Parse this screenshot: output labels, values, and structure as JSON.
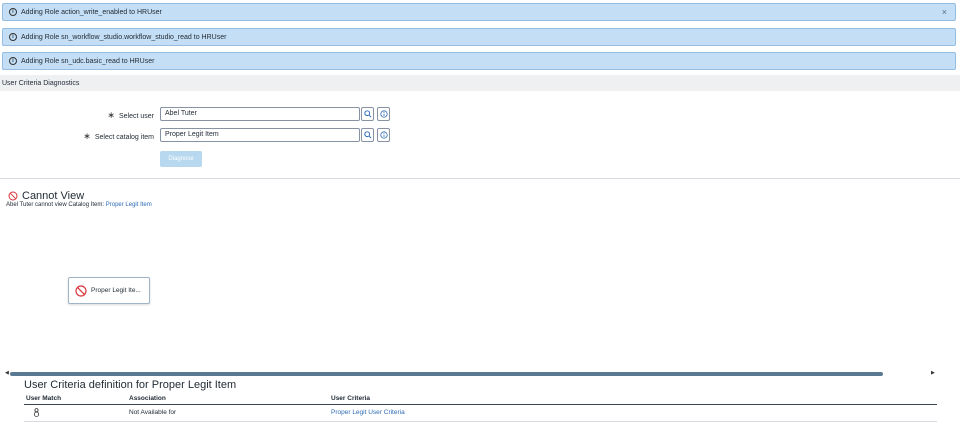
{
  "banners": [
    {
      "text": "Adding Role action_write_enabled to HRUser",
      "close": "×"
    },
    {
      "text": "Adding Role sn_workflow_studio.workflow_studio_read to HRUser"
    },
    {
      "text": "Adding Role sn_udc.basic_read to HRUser"
    }
  ],
  "section": {
    "title": "User Criteria Diagnostics"
  },
  "form": {
    "user_label": "Select user",
    "user_value": "Abel Tuter",
    "item_label": "Select catalog item",
    "item_value": "Proper Legit Item",
    "diagnose_label": "Diagnose"
  },
  "result": {
    "title": "Cannot View",
    "sub_prefix": "Abel Tuter cannot view Catalog Item:",
    "sub_link": "Proper Legit Item"
  },
  "node": {
    "label": "Proper Legit Ite..."
  },
  "definition": {
    "title": "User Criteria definition for Proper Legit Item",
    "headers": [
      "User Match",
      "Association",
      "User Criteria"
    ],
    "rows": [
      {
        "association": "Not Available for",
        "criteria": "Proper Legit User Criteria"
      }
    ]
  },
  "colors": {
    "banner_bg": "#c4def5",
    "link": "#2e6bb5",
    "error": "#d9363e"
  }
}
